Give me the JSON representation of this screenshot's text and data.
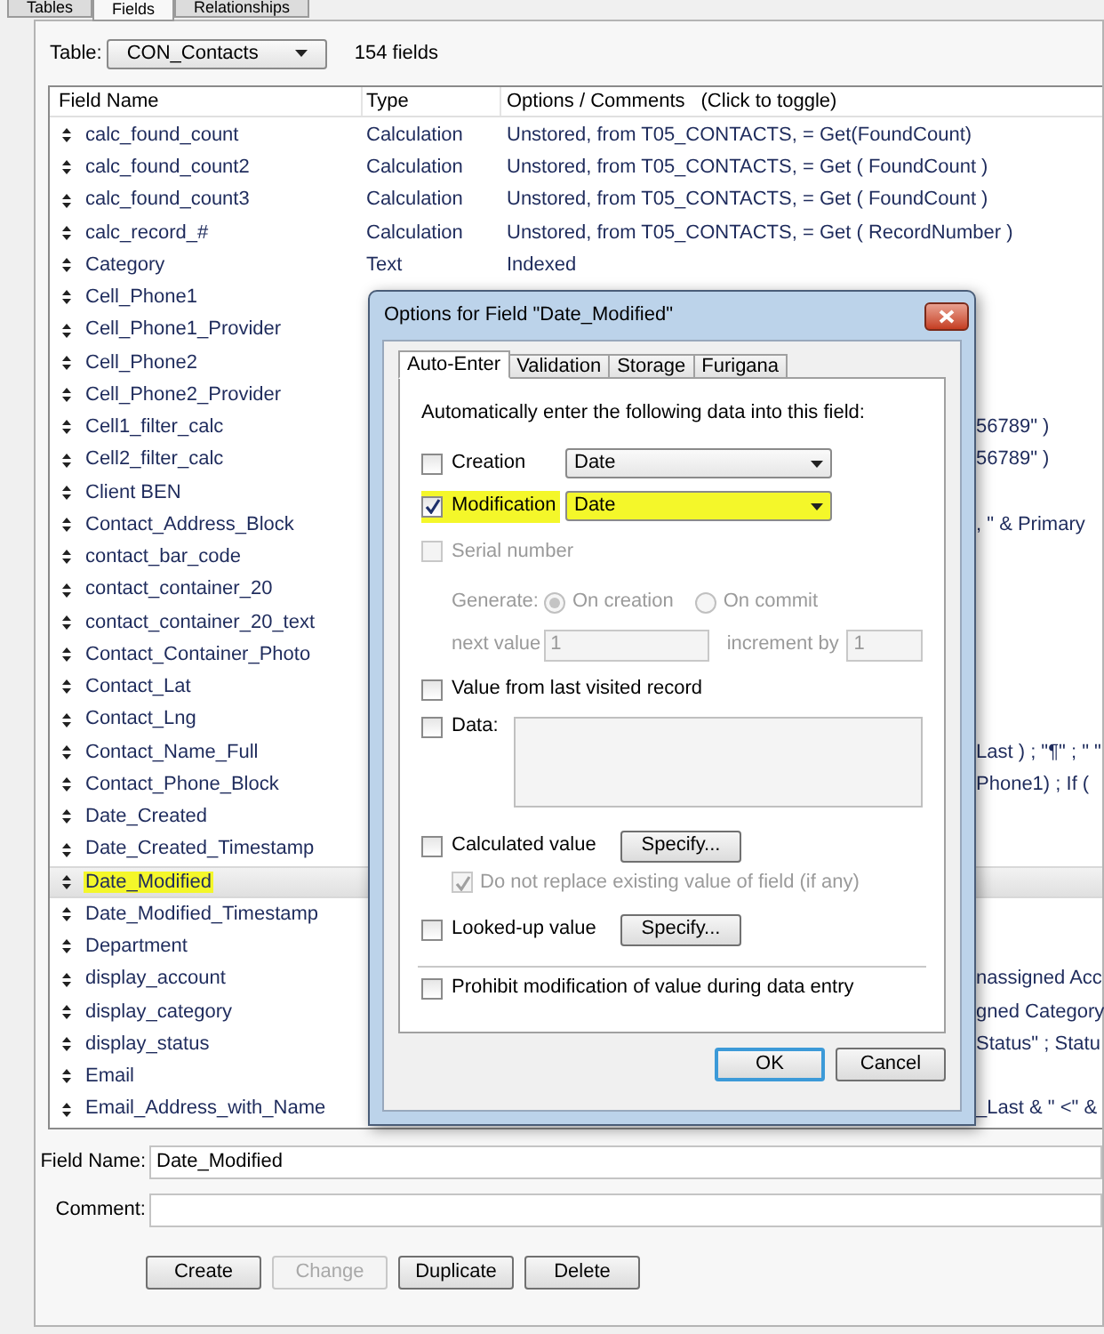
{
  "tabs": [
    {
      "label": "Tables",
      "selected": false
    },
    {
      "label": "Fields",
      "selected": true
    },
    {
      "label": "Relationships",
      "selected": false
    }
  ],
  "table_selector": {
    "label": "Table:",
    "value": "CON_Contacts",
    "count": "154 fields"
  },
  "columns": [
    {
      "label": "Field Name"
    },
    {
      "label": "Type"
    },
    {
      "label": "Options / Comments",
      "hint": "(Click to toggle)"
    }
  ],
  "rows": [
    {
      "name": "calc_found_count",
      "type": "Calculation",
      "options": "Unstored, from T05_CONTACTS, = Get(FoundCount)",
      "selected": false
    },
    {
      "name": "calc_found_count2",
      "type": "Calculation",
      "options": "Unstored, from T05_CONTACTS, = Get ( FoundCount )",
      "selected": false
    },
    {
      "name": "calc_found_count3",
      "type": "Calculation",
      "options": "Unstored, from T05_CONTACTS, = Get ( FoundCount )",
      "selected": false
    },
    {
      "name": "calc_record_#",
      "type": "Calculation",
      "options": "Unstored, from T05_CONTACTS, = Get ( RecordNumber )",
      "selected": false
    },
    {
      "name": "Category",
      "type": "Text",
      "options": "Indexed",
      "selected": false
    },
    {
      "name": "Cell_Phone1",
      "selected": false
    },
    {
      "name": "Cell_Phone1_Provider",
      "selected": false
    },
    {
      "name": "Cell_Phone2",
      "selected": false
    },
    {
      "name": "Cell_Phone2_Provider",
      "selected": false
    },
    {
      "name": "Cell1_filter_calc",
      "options_tail": "56789\" )",
      "selected": false
    },
    {
      "name": "Cell2_filter_calc",
      "options_tail": "56789\" )",
      "selected": false
    },
    {
      "name": "Client BEN",
      "selected": false
    },
    {
      "name": "Contact_Address_Block",
      "options_tail": ", \" & Primary",
      "selected": false
    },
    {
      "name": "contact_bar_code",
      "selected": false
    },
    {
      "name": "contact_container_20",
      "selected": false
    },
    {
      "name": "contact_container_20_text",
      "selected": false
    },
    {
      "name": "Contact_Container_Photo",
      "selected": false
    },
    {
      "name": "Contact_Lat",
      "selected": false
    },
    {
      "name": "Contact_Lng",
      "selected": false
    },
    {
      "name": "Contact_Name_Full",
      "options_tail": "Last ) ; \"¶\" ; \" \"",
      "selected": false
    },
    {
      "name": "Contact_Phone_Block",
      "options_tail": "Phone1) ; If (",
      "selected": false
    },
    {
      "name": "Date_Created",
      "selected": false
    },
    {
      "name": "Date_Created_Timestamp",
      "selected": false
    },
    {
      "name": "Date_Modified",
      "selected": true,
      "highlighted": true
    },
    {
      "name": "Date_Modified_Timestamp",
      "selected": false
    },
    {
      "name": "Department",
      "selected": false
    },
    {
      "name": "display_account",
      "options_tail": "nassigned Acc",
      "selected": false
    },
    {
      "name": "display_category",
      "options_tail": "gned Category",
      "selected": false
    },
    {
      "name": "display_status",
      "options_tail": "Status\" ; Statu",
      "selected": false
    },
    {
      "name": "Email",
      "selected": false
    },
    {
      "name": "Email_Address_with_Name",
      "options_tail": "_Last & \" <\" &",
      "selected": false
    }
  ],
  "field_name": {
    "label": "Field Name:",
    "value": "Date_Modified"
  },
  "comment": {
    "label": "Comment:"
  },
  "buttons": [
    {
      "label": "Create",
      "disabled": false
    },
    {
      "label": "Change",
      "disabled": true
    },
    {
      "label": "Duplicate",
      "disabled": false
    },
    {
      "label": "Delete",
      "disabled": false
    }
  ],
  "dialog": {
    "title": "Options for Field \"Date_Modified\"",
    "tabs": [
      {
        "label": "Auto-Enter",
        "selected": true
      },
      {
        "label": "Validation",
        "selected": false
      },
      {
        "label": "Storage",
        "selected": false
      },
      {
        "label": "Furigana",
        "selected": false
      }
    ],
    "instruction": "Automatically enter the following data into this field:",
    "selects": [
      {
        "label": "Creation",
        "checked": false,
        "value": "Date",
        "highlighted": false
      },
      {
        "label": "Modification",
        "checked": true,
        "value": "Date",
        "highlighted": true
      }
    ],
    "serial": {
      "label": "Serial number",
      "checked": false,
      "disabled": true,
      "generate_label": "Generate:",
      "options": [
        {
          "label": "On creation",
          "selected": true
        },
        {
          "label": "On commit",
          "selected": false
        }
      ],
      "next_label": "next value",
      "next_value": "1",
      "increment_label": "increment by",
      "increment_value": "1"
    },
    "last_visited": {
      "label": "Value from last visited record",
      "checked": false
    },
    "data": {
      "label": "Data:",
      "checked": false
    },
    "calculated": {
      "label": "Calculated value",
      "checked": false,
      "button": "Specify...",
      "sub": {
        "label": "Do not replace existing value of field (if any)",
        "checked": true,
        "disabled": true
      }
    },
    "looked_up": {
      "label": "Looked-up value",
      "checked": false,
      "button": "Specify..."
    },
    "prohibit": {
      "label": "Prohibit modification of value during data entry",
      "checked": false
    },
    "buttons": [
      {
        "label": "OK",
        "default": true
      },
      {
        "label": "Cancel",
        "default": false
      }
    ]
  }
}
